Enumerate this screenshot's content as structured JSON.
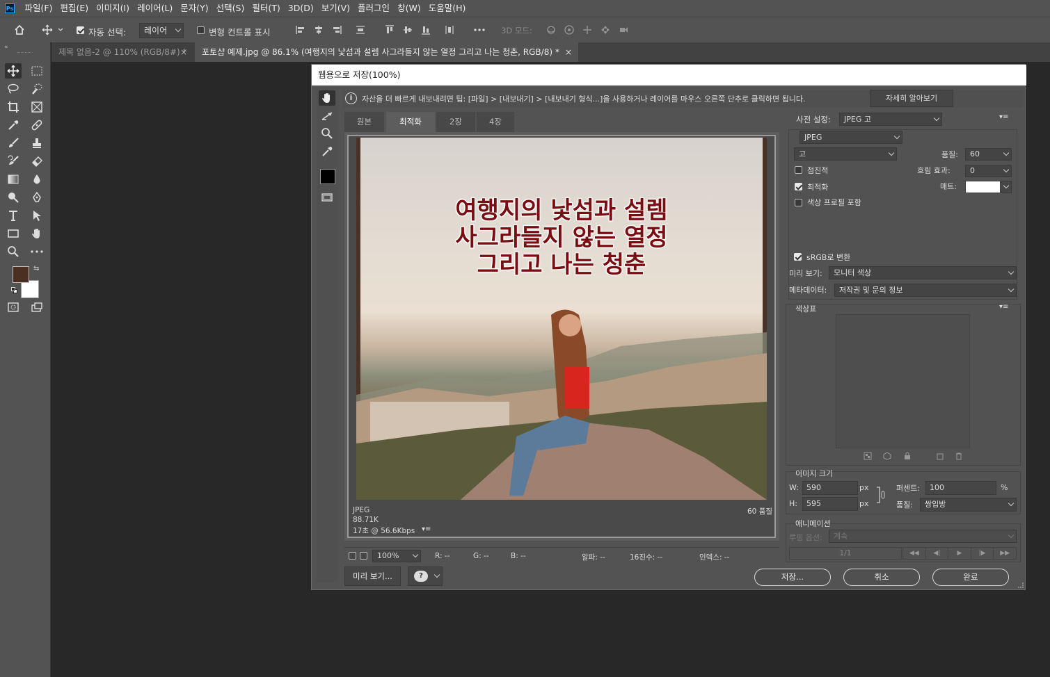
{
  "menubar": {
    "items": [
      "파일(F)",
      "편집(E)",
      "이미지(I)",
      "레이어(L)",
      "문자(Y)",
      "선택(S)",
      "필터(T)",
      "3D(D)",
      "보기(V)",
      "플러그인",
      "창(W)",
      "도움말(H)"
    ],
    "logo": "Ps"
  },
  "options": {
    "auto_select_label": "자동 선택:",
    "auto_select_value": "레이어",
    "transform_label": "변형 컨트롤 표시",
    "mode3d_label": "3D 모드:"
  },
  "tabs": [
    {
      "label": "제목 없음-2 @ 110% (RGB/8#) *"
    },
    {
      "label": "포토샵 예제.jpg @ 86.1% (여행지의 낯섬과 설렘 사그라들지 않는 열정 그리고 나는 청춘, RGB/8) *"
    }
  ],
  "colors": {
    "foreground": "#4a2f22",
    "background": "#ffffff",
    "accent": "#31a8ff"
  },
  "dialog": {
    "title": "웹용으로 저장(100%)",
    "tip": "자산을 더 빠르게 내보내려면 팁: [파일] > [내보내기] > [내보내기 형식...]을 사용하거나 레이어를 마우스 오른쪽 단추로 클릭하면 됩니다.",
    "learn_more": "자세히 알아보기",
    "view_tabs": [
      "원본",
      "최적화",
      "2장",
      "4장"
    ],
    "image_text": [
      "여행지의 낯섬과 설렘",
      "사그라들지 않는 열정",
      "그리고 나는 청춘"
    ],
    "info": {
      "format": "JPEG",
      "size": "88.71K",
      "time": "17초 @ 56.6Kbps",
      "quality": "60 품질"
    },
    "status": {
      "zoom": "100%",
      "r": "R: --",
      "g": "G: --",
      "b": "B: --",
      "alpha": "알파: --",
      "hex": "16진수: --",
      "index": "인덱스: --"
    },
    "preview_button": "미리 보기...",
    "save_button": "저장...",
    "cancel_button": "취소",
    "done_button": "완료",
    "preset_label": "사전 설정:",
    "preset_value": "JPEG 고",
    "format_value": "JPEG",
    "compression_value": "고",
    "quality_label": "품질:",
    "quality_value": "60",
    "blur_label": "흐림 효과:",
    "blur_value": "0",
    "matte_label": "매트:",
    "progressive_label": "점진적",
    "optimized_label": "최적화",
    "embed_profile_label": "색상 프로필 포함",
    "srgb_label": "sRGB로 변환",
    "preview_label": "미리 보기:",
    "preview_value": "모니터 색상",
    "metadata_label": "메타데이터:",
    "metadata_value": "저작권 및 문의 정보",
    "color_table_label": "색상표",
    "image_size_label": "이미지 크기",
    "w_label": "W:",
    "w_value": "590",
    "h_label": "H:",
    "h_value": "595",
    "px": "px",
    "percent_label": "퍼센트:",
    "percent_value": "100",
    "percent_unit": "%",
    "resample_label": "품질:",
    "resample_value": "쌍입방",
    "animation_label": "애니메이션",
    "loop_label": "루핑 옵션:",
    "loop_value": "계속",
    "frame_counter": "1/1"
  }
}
